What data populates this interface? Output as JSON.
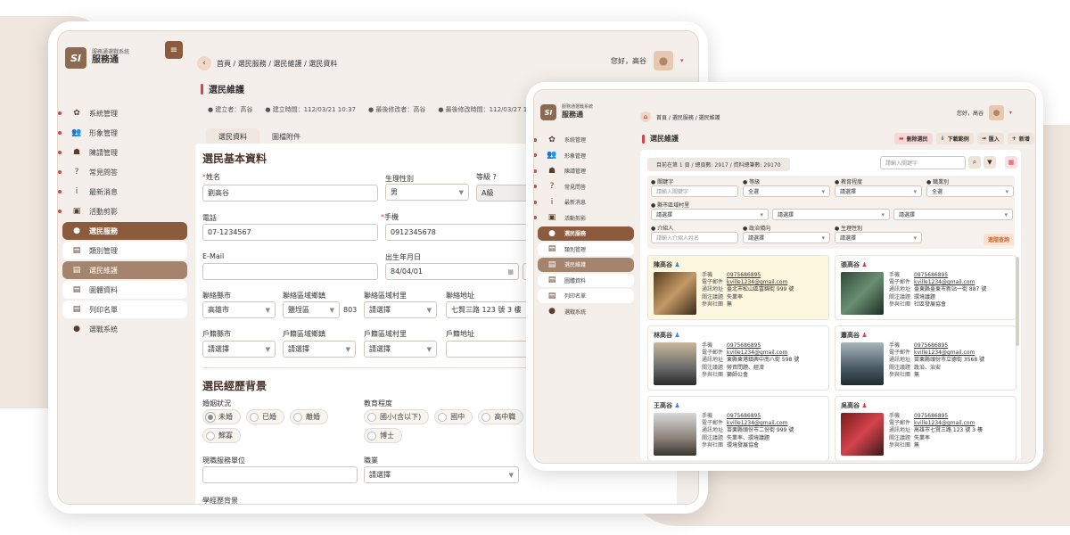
{
  "colors": {
    "brand": "#8c5a3c",
    "accent_red": "#d4434b",
    "male": "#3a86d4",
    "female": "#d4434b"
  },
  "left": {
    "logo_mark": "SI",
    "logo_small": "服務通選戰系統",
    "logo_big": "服務通",
    "greeting": "您好，高谷",
    "breadcrumb": "首頁 / 選民服務 / 選民維護 / 選民資料",
    "nav": [
      {
        "icon": "gear-icon",
        "glyph": "✿",
        "label": "系統管理"
      },
      {
        "icon": "person-gear-icon",
        "glyph": "👥",
        "label": "形象管理"
      },
      {
        "icon": "podium-icon",
        "glyph": "☗",
        "label": "陳請管理"
      },
      {
        "icon": "question-icon",
        "glyph": "?",
        "label": "常見問答"
      },
      {
        "icon": "info-icon",
        "glyph": "i",
        "label": "最新消息"
      },
      {
        "icon": "image-icon",
        "glyph": "▣",
        "label": "活動剪影"
      },
      {
        "icon": "user-icon",
        "glyph": "●",
        "label": "選民服務"
      },
      {
        "icon": "file-icon",
        "glyph": "▤",
        "label": "類別管理"
      },
      {
        "icon": "file-icon",
        "glyph": "▤",
        "label": "選民維護"
      },
      {
        "icon": "file-icon",
        "glyph": "▤",
        "label": "圖體資料"
      },
      {
        "icon": "file-icon",
        "glyph": "▤",
        "label": "列印名單"
      },
      {
        "icon": "user-icon",
        "glyph": "●",
        "label": "選戰系統"
      }
    ],
    "page_title": "選民維護",
    "meta": {
      "creator": "建立者：高谷",
      "created": "建立時間：112/03/21 10:37",
      "modifier": "最後修改者：高谷",
      "modified": "最後修改時間：112/03/27 1"
    },
    "tabs": [
      "選民資料",
      "圖檔附件"
    ],
    "section1": "選民基本資料",
    "fields": {
      "name_label": "姓名",
      "name_value": "劉高谷",
      "gender_label": "生理性別",
      "gender_value": "男",
      "grade_label": "等級",
      "grade_value": "A級",
      "phone_label": "電話",
      "phone_value": "07-1234567",
      "mobile_label": "手機",
      "mobile_value": "0912345678",
      "email_label": "E-Mail",
      "email_value": "",
      "birth_label": "出生年月日",
      "birth_value": "84/04/01",
      "city_label": "聯絡縣市",
      "city_value": "高雄市",
      "dist_label": "聯絡區域鄉鎮",
      "dist_value": "鹽埕區",
      "zip": "803",
      "village_label": "聯絡區域村里",
      "village_value": "請選擇",
      "addr_label": "聯絡地址",
      "addr_value": "七賢三路 123 號 3 樓",
      "rcity_label": "戶籍縣市",
      "rcity_value": "請選擇",
      "rdist_label": "戶籍區域鄉鎮",
      "rdist_value": "請選擇",
      "rvillage_label": "戶籍區域村里",
      "rvillage_value": "請選擇",
      "raddr_label": "戶籍地址",
      "raddr_value": ""
    },
    "section2": "選民經歷背景",
    "marital_label": "婚姻狀況",
    "marital": [
      "未婚",
      "已婚",
      "離婚",
      "鰥寡"
    ],
    "edu_label": "教育程度",
    "edu": [
      "國小(含以下)",
      "國中",
      "高中職",
      "博士"
    ],
    "work_label": "現職服務單位",
    "job_label": "職業",
    "job_value": "請選擇",
    "school_label": "學經歷背景"
  },
  "right": {
    "logo_mark": "SI",
    "logo_small": "服務通選戰系統",
    "logo_big": "服務通",
    "greeting": "您好，高谷",
    "breadcrumb": "首頁 / 選民服務 / 選民維護",
    "nav": [
      {
        "icon": "gear-icon",
        "glyph": "✿",
        "label": "系統管理"
      },
      {
        "icon": "person-gear-icon",
        "glyph": "👥",
        "label": "形象管理"
      },
      {
        "icon": "podium-icon",
        "glyph": "☗",
        "label": "陳請管理"
      },
      {
        "icon": "question-icon",
        "glyph": "?",
        "label": "常見問答"
      },
      {
        "icon": "info-icon",
        "glyph": "i",
        "label": "最新消息"
      },
      {
        "icon": "image-icon",
        "glyph": "▣",
        "label": "活動剪影"
      },
      {
        "icon": "user-icon",
        "glyph": "●",
        "label": "選民服務"
      },
      {
        "icon": "file-icon",
        "glyph": "▤",
        "label": "類別管理"
      },
      {
        "icon": "file-icon",
        "glyph": "▤",
        "label": "選民維護"
      },
      {
        "icon": "file-icon",
        "glyph": "▤",
        "label": "圖體資料"
      },
      {
        "icon": "file-icon",
        "glyph": "▤",
        "label": "列印名單"
      },
      {
        "icon": "user-icon",
        "glyph": "●",
        "label": "選戰系統"
      }
    ],
    "page_title": "選民維護",
    "actions": [
      "刪除選民",
      "下載範例",
      "匯入",
      "新增"
    ],
    "status": "目前在第 1 頁 / 總頁數: 2917 / 資料總筆數: 29170",
    "search_placeholder": "請輸入關鍵字",
    "filters": {
      "keyword_label": "關鍵字",
      "keyword_ph": "請輸入關鍵字",
      "grade_label": "等級",
      "grade_value": "全選",
      "edu_label": "教育程度",
      "edu_value": "請選擇",
      "job_label": "職業別",
      "job_value": "全選",
      "region_label": "縣市區域村里",
      "region_values": [
        "請選擇",
        "請選擇",
        "請選擇"
      ],
      "intro_label": "介紹人",
      "intro_ph": "請輸入介紹人姓名",
      "politic_label": "政治傾向",
      "politic_value": "請選擇",
      "gender_label": "生理性別",
      "gender_value": "請選擇",
      "adv_button": "進階查詢"
    },
    "field_labels": [
      "手機",
      "電子郵件",
      "通訊地址",
      "關注議題",
      "參與社團"
    ],
    "cards": [
      {
        "name": "陳高谷",
        "sex": "male",
        "phone": "0975686895",
        "email": "kville1234@gmail.com",
        "addr": "臺北市松山區富錦街 999 號",
        "issue": "失業率",
        "club": "無"
      },
      {
        "name": "張高谷",
        "sex": "female",
        "phone": "0975686895",
        "email": "kville1234@gmail.com",
        "addr": "臺東縣臺東市新站一街 887 號",
        "issue": "環境議題",
        "club": "社區發展協會"
      },
      {
        "name": "林高谷",
        "sex": "male",
        "phone": "0975686895",
        "email": "kville1234@gmail.com",
        "addr": "東縣東港鎮興中南八街 598 號",
        "issue": "勞資問題、經濟",
        "club": "獅師公會"
      },
      {
        "name": "蕭高谷",
        "sex": "female",
        "phone": "0975686895",
        "email": "kville1234@gmail.com",
        "addr": "苗栗縣頭份市立德街 3568 號",
        "issue": "政治、治安",
        "club": "無"
      },
      {
        "name": "王高谷",
        "sex": "male",
        "phone": "0975686895",
        "email": "kville1234@gmail.com",
        "addr": "苗栗縣頭份市二份街 999 號",
        "issue": "失業率、環境議題",
        "club": "環境發展協會"
      },
      {
        "name": "吳高谷",
        "sex": "female",
        "phone": "0975686895",
        "email": "kville1234@gmail.com",
        "addr": "高雄市七賢三路 123 號 3 樓",
        "issue": "失業率",
        "club": "無"
      }
    ]
  }
}
